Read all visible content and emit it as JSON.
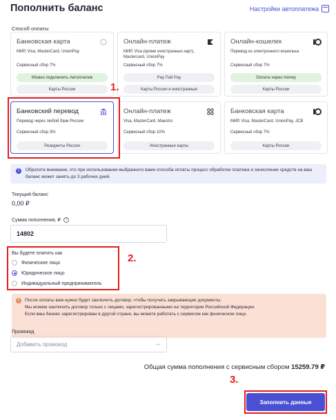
{
  "header": {
    "title": "Пополнить баланс",
    "autopay_link": "Настройки автоплатежа",
    "autopay_icon": "calendar-icon"
  },
  "payment_method_label": "Способ оплаты",
  "cards": [
    {
      "title": "Банковская карта",
      "desc": "МИР, Visa, MasterCard, UnionPay",
      "fee": "Сервисный сбор 7%",
      "badge": "Можно подключить Автоплатеж",
      "footer": "Карты России",
      "icon": "card-icon"
    },
    {
      "title": "Онлайн-платеж",
      "desc": "МИР, Visa (кроме иностранных карт), Mastercard, UnionPay",
      "fee": "Сервисный сбор 7%",
      "badge": "Pay  Пэй  Pay",
      "footer": "Карты России и иностранные",
      "icon": "flag-icon"
    },
    {
      "title": "Онлайн-кошелек",
      "desc": "Перевод из электронного кошелька",
      "fee": "Сервисный сбор 7%",
      "badge": "Оплата через  money",
      "footer": "Карты России",
      "icon": "yoomoney-icon"
    },
    {
      "title": "Банковский перевод",
      "desc": "Перевод через любой банк России",
      "fee": "Сервисный сбор 3%",
      "badge": "",
      "footer": "Резиденты России",
      "icon": "bank-icon"
    },
    {
      "title": "Онлайн-платеж",
      "desc": "Visa, MasterCard, Maestro",
      "fee": "Сервисный сбор 10%",
      "badge": "",
      "footer": "Иностранные карты",
      "icon": "grid-icon"
    },
    {
      "title": "Банковская карта",
      "desc": "МИР, Visa, MasterCard, UnionPay, JCB",
      "fee": "Сервисный сбор 7%",
      "badge": "",
      "footer": "Карты России",
      "icon": "yoomoney-icon"
    }
  ],
  "notice": "Обратите внимание, что при использовании выбранного вами способа оплаты процесс обработки платежа и зачисление средств на ваш баланс может занять до 3 рабочих дней.",
  "balance": {
    "label": "Текущий баланс",
    "value": "0,00 ₽"
  },
  "amount": {
    "label": "Сумма пополнения, ₽",
    "value": "14802"
  },
  "payer": {
    "label": "Вы будете платить как",
    "options": [
      "Физическое лицо",
      "Юридическое лицо",
      "Индивидуальный предприниматель"
    ],
    "selected_index": 1
  },
  "warning": {
    "line1": "После оплаты вам нужно будет заключить договор, чтобы получать закрывающие документы.",
    "line2": "Мы можем заключить договор только с лицами, зарегистрированными на территории Российской Федерации.",
    "line3": "Если ваш бизнес зарегистрирован в другой стране, вы можете работать с сервисом как физическое лицо."
  },
  "promo": {
    "label": "Промокод",
    "placeholder": "Добавить промокод"
  },
  "total": {
    "text": "Общая сумма пополнения с сервисным сбором",
    "value": "15259.79 ₽"
  },
  "submit_label": "Заполнить данные",
  "annotations": {
    "n1": "1.",
    "n2": "2.",
    "n3": "3."
  },
  "colors": {
    "accent": "#4a4fd3",
    "annotation": "#e31b1b",
    "notice_bg": "#eceefc",
    "warning_bg": "#fbe0d6"
  }
}
